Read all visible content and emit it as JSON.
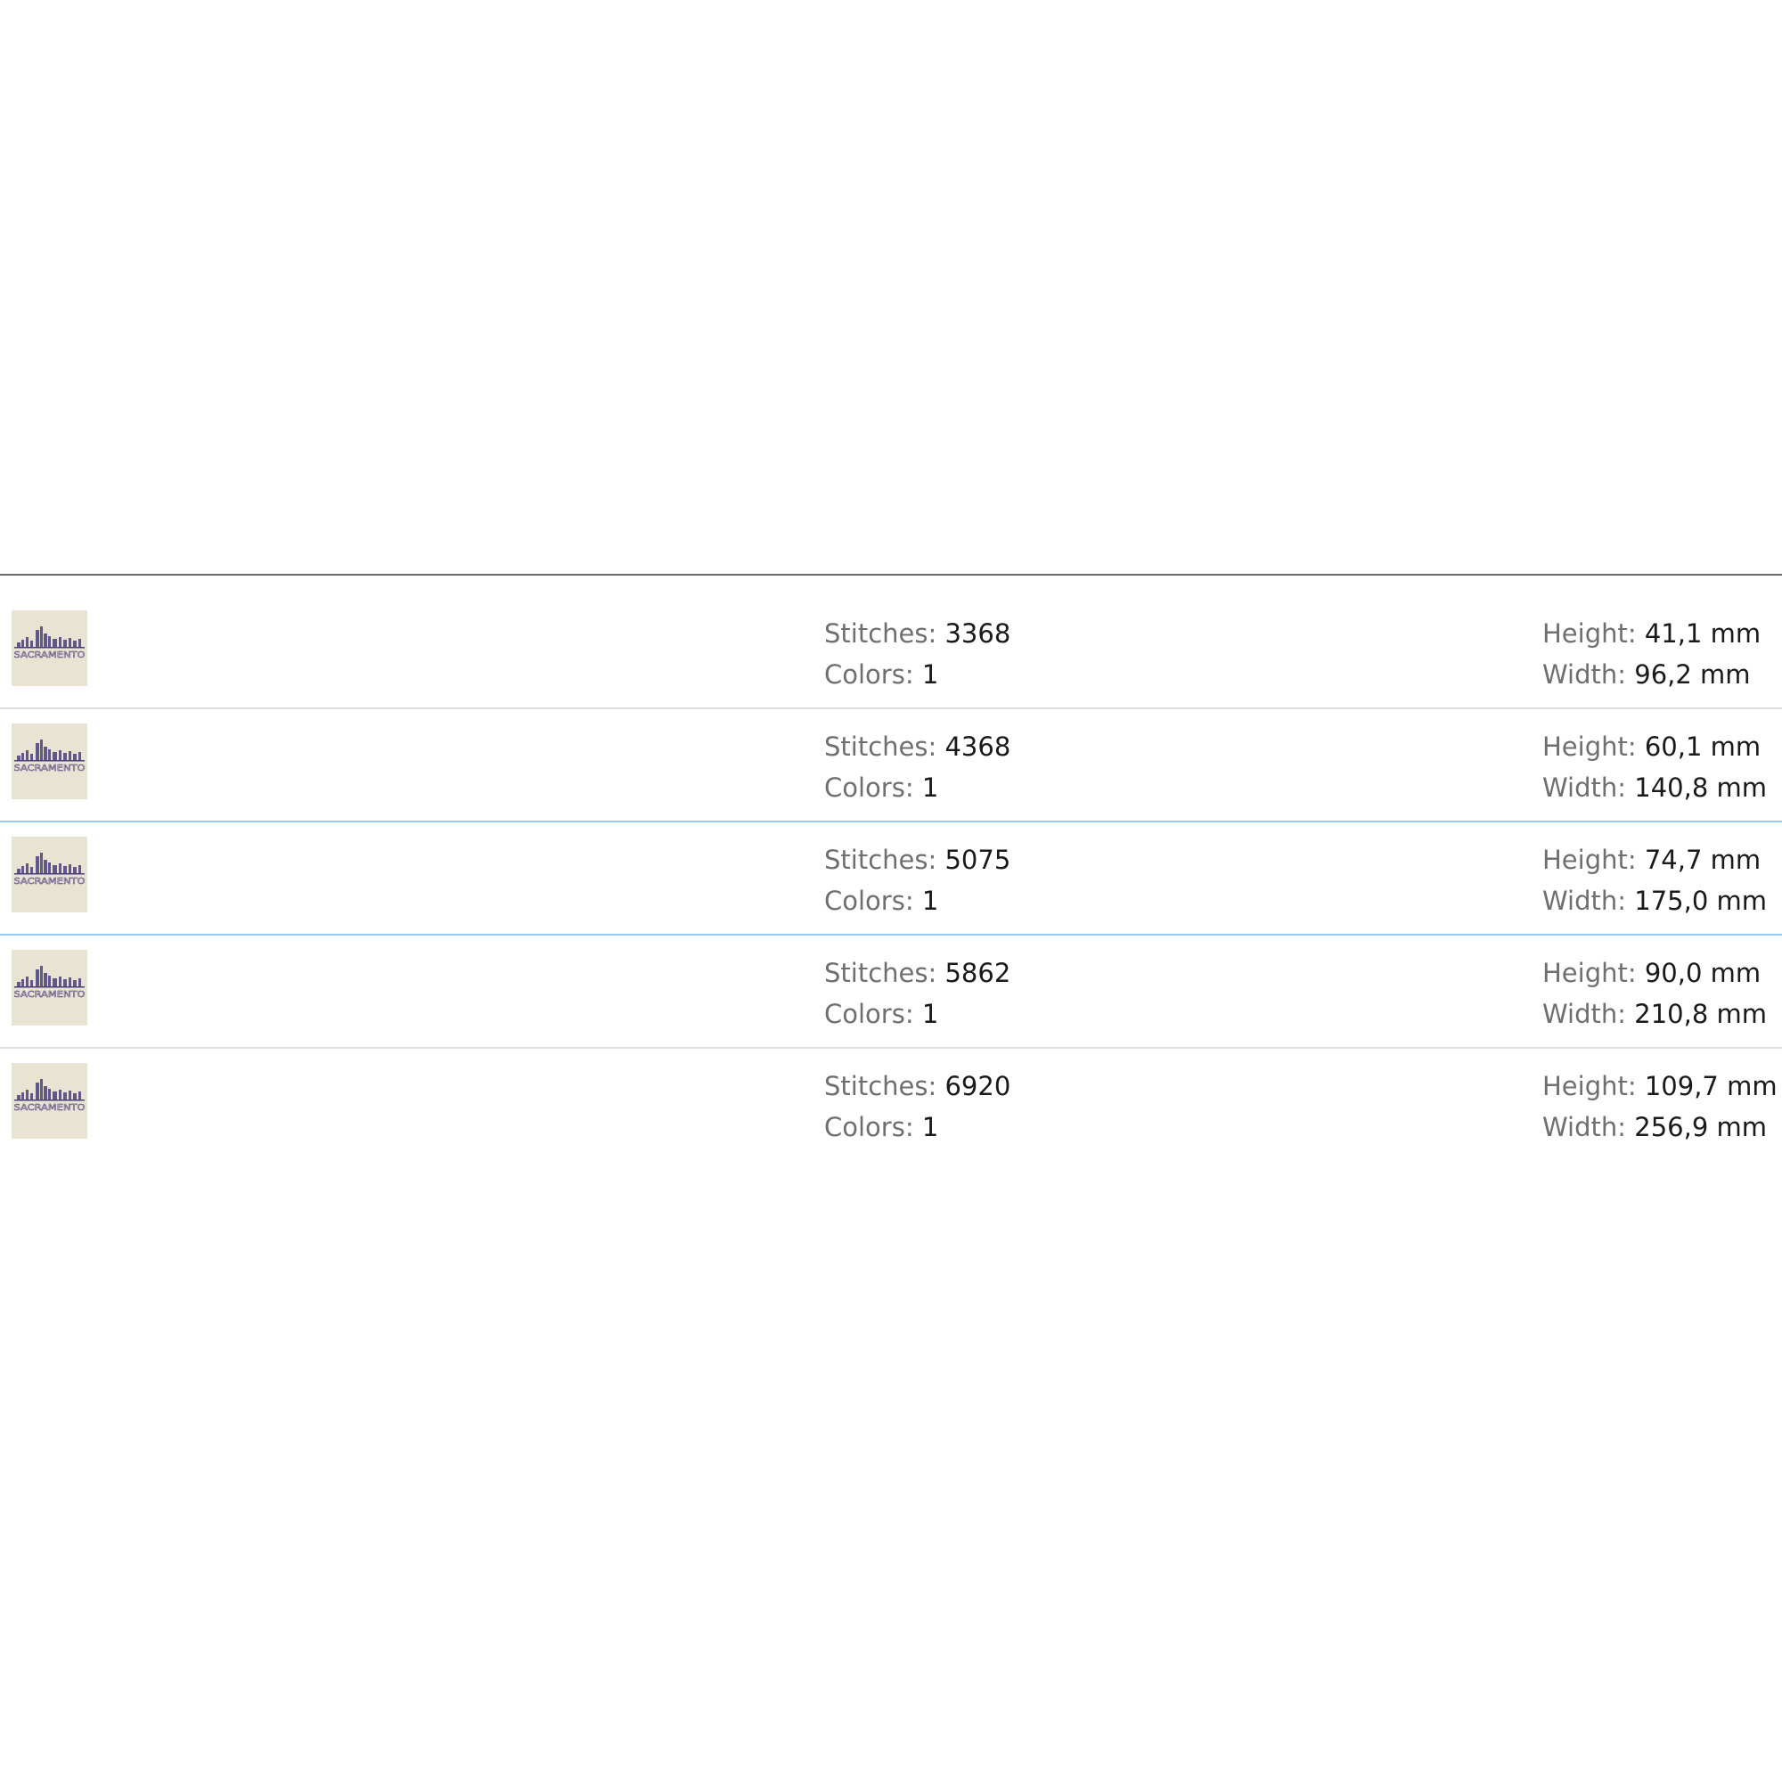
{
  "rows": [
    {
      "stitches_label": "Stitches:",
      "stitches": "3368",
      "colors_label": "Colors:",
      "colors": "1",
      "height_label": "Height:",
      "height": "41,1 mm",
      "width_label": "Width:",
      "width": "96,2 mm"
    },
    {
      "stitches_label": "Stitches:",
      "stitches": "4368",
      "colors_label": "Colors:",
      "colors": "1",
      "height_label": "Height:",
      "height": "60,1 mm",
      "width_label": "Width:",
      "width": "140,8 mm"
    },
    {
      "stitches_label": "Stitches:",
      "stitches": "5075",
      "colors_label": "Colors:",
      "colors": "1",
      "height_label": "Height:",
      "height": "74,7 mm",
      "width_label": "Width:",
      "width": "175,0 mm"
    },
    {
      "stitches_label": "Stitches:",
      "stitches": "5862",
      "colors_label": "Colors:",
      "colors": "1",
      "height_label": "Height:",
      "height": "90,0 mm",
      "width_label": "Width:",
      "width": "210,8 mm"
    },
    {
      "stitches_label": "Stitches:",
      "stitches": "6920",
      "colors_label": "Colors:",
      "colors": "1",
      "height_label": "Height:",
      "height": "109,7 mm",
      "width_label": "Width:",
      "width": "256,9 mm"
    }
  ],
  "thumbnail_icon": "skyline-embroidery-thumbnail",
  "thumbnail_text": "SACRAMENTO",
  "colors": {
    "divider": "#dcdcdc",
    "selection_border": "#9cc8ea",
    "header_rule": "#6b6b6b",
    "thumb_bg": "#e8e3d2",
    "thumb_ink": "#4a3f7a"
  }
}
